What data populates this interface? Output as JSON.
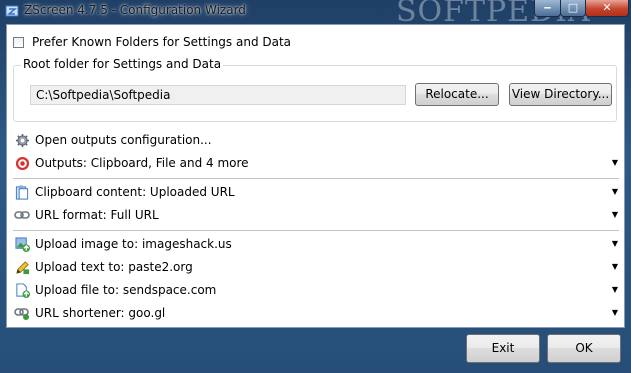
{
  "window": {
    "title": "ZScreen 4.7.5 - Configuration Wizard",
    "watermark": "SOFTPEDIA",
    "minimize_label": "‒",
    "maximize_label": "□",
    "close_label": "✕"
  },
  "prefs": {
    "known_folders_label": "Prefer Known Folders for Settings and Data",
    "known_folders_checked": false
  },
  "root_folder": {
    "group_label": "Root folder for Settings and Data",
    "path_value": "C:\\Softpedia\\Softpedia",
    "relocate_label": "Relocate...",
    "view_directory_label": "View Directory..."
  },
  "items": [
    {
      "label": "Open outputs configuration...",
      "icon": "gear-icon",
      "has_arrow": false
    },
    {
      "label": "Outputs: Clipboard, File and 4 more",
      "icon": "target-icon",
      "has_arrow": true
    },
    {
      "label": "Clipboard content: Uploaded URL",
      "icon": "clipboard-icon",
      "has_arrow": true
    },
    {
      "label": "URL format: Full URL",
      "icon": "link-icon",
      "has_arrow": true
    },
    {
      "label": "Upload image to: imageshack.us",
      "icon": "image-upload-icon",
      "has_arrow": true
    },
    {
      "label": "Upload text to: paste2.org",
      "icon": "pencil-icon",
      "has_arrow": true
    },
    {
      "label": "Upload file to: sendspace.com",
      "icon": "file-upload-icon",
      "has_arrow": true
    },
    {
      "label": "URL shortener: goo.gl",
      "icon": "chain-link-icon",
      "has_arrow": true
    }
  ],
  "footer": {
    "exit_label": "Exit",
    "ok_label": "OK"
  },
  "colors": {
    "accent_red": "#d9302b",
    "icon_green": "#3b9a3b",
    "icon_blue": "#3a73c8"
  }
}
